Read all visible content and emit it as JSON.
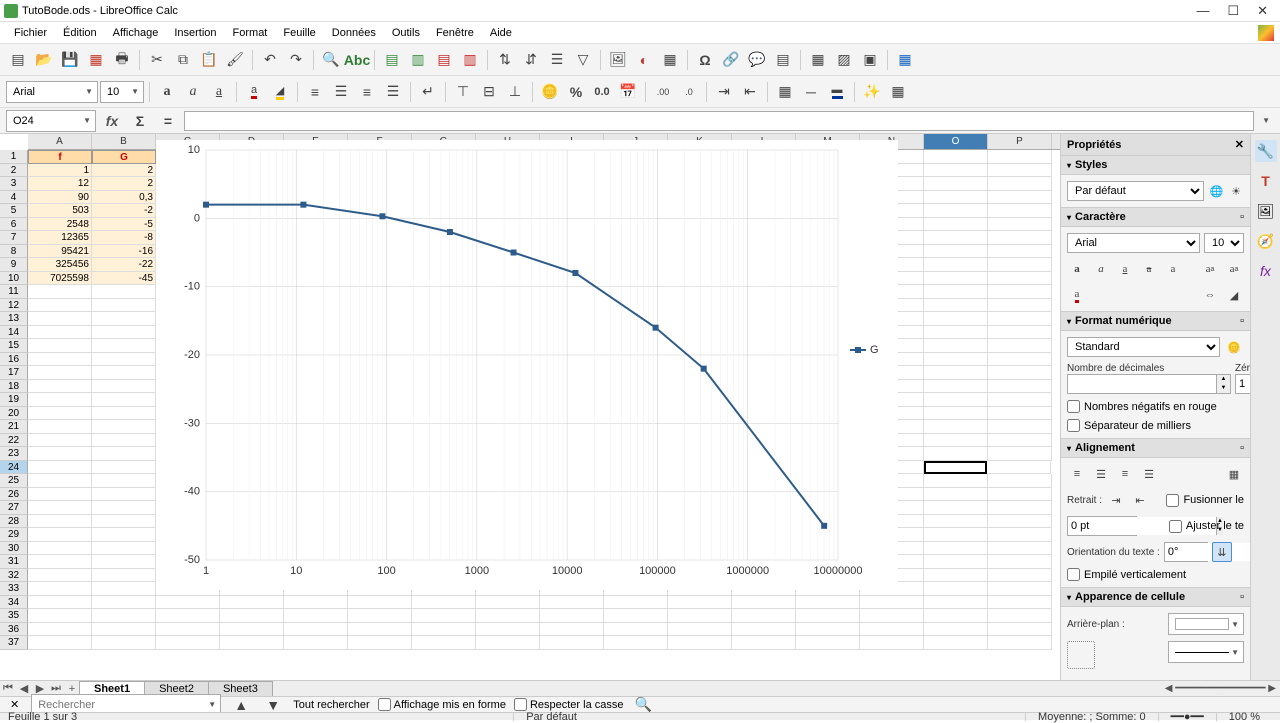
{
  "window": {
    "title": "TutoBode.ods - LibreOffice Calc"
  },
  "menus": [
    "Fichier",
    "Édition",
    "Affichage",
    "Insertion",
    "Format",
    "Feuille",
    "Données",
    "Outils",
    "Fenêtre",
    "Aide"
  ],
  "font": {
    "name": "Arial",
    "size": "10"
  },
  "cell_ref": "O24",
  "columns": [
    "A",
    "B",
    "C",
    "D",
    "E",
    "F",
    "G",
    "H",
    "I",
    "J",
    "K",
    "L",
    "M",
    "N",
    "O",
    "P"
  ],
  "headers": {
    "A": "f",
    "B": "G"
  },
  "table": [
    {
      "f": "1",
      "G": "2"
    },
    {
      "f": "12",
      "G": "2"
    },
    {
      "f": "90",
      "G": "0,3"
    },
    {
      "f": "503",
      "G": "-2"
    },
    {
      "f": "2548",
      "G": "-5"
    },
    {
      "f": "12365",
      "G": "-8"
    },
    {
      "f": "95421",
      "G": "-16"
    },
    {
      "f": "325456",
      "G": "-22"
    },
    {
      "f": "7025598",
      "G": "-45"
    }
  ],
  "chart_data": {
    "type": "line",
    "x": [
      1,
      12,
      90,
      503,
      2548,
      12365,
      95421,
      325456,
      7025598
    ],
    "series": [
      {
        "name": "G",
        "values": [
          2,
          2,
          0.3,
          -2,
          -5,
          -8,
          -16,
          -22,
          -45
        ]
      }
    ],
    "ylim": [
      -50,
      10
    ],
    "xlim": [
      1,
      10000000
    ],
    "xscale": "log",
    "xticks": [
      1,
      10,
      100,
      1000,
      10000,
      100000,
      1000000,
      10000000
    ],
    "yticks": [
      -50,
      -40,
      -30,
      -20,
      -10,
      0,
      10
    ]
  },
  "props": {
    "title": "Propriétés",
    "styles": {
      "label": "Styles",
      "value": "Par défaut"
    },
    "character": {
      "label": "Caractère",
      "font": "Arial",
      "size": "10"
    },
    "numformat": {
      "label": "Format numérique",
      "value": "Standard",
      "decimals_label": "Nombre de décimales",
      "leading_label": "Zéros non sign",
      "leading_value": "1",
      "neg_red": "Nombres négatifs en rouge",
      "thousands": "Séparateur de milliers"
    },
    "alignment": {
      "label": "Alignement",
      "indent_label": "Retrait :",
      "indent_value": "0 pt",
      "merge": "Fusionner le",
      "wrap": "Ajuster le te",
      "orient_label": "Orientation du texte :",
      "orient_value": "0°",
      "stacked": "Empilé verticalement"
    },
    "cellapp": {
      "label": "Apparence de cellule",
      "bg_label": "Arrière-plan :"
    }
  },
  "sheets": [
    "Sheet1",
    "Sheet2",
    "Sheet3"
  ],
  "find": {
    "placeholder": "Rechercher",
    "all": "Tout rechercher",
    "formatted": "Affichage mis en forme",
    "case": "Respecter la casse"
  },
  "status": {
    "sheet": "Feuille 1 sur 3",
    "style": "Par défaut",
    "stats": "Moyenne: ; Somme: 0",
    "zoom": "100 %"
  }
}
